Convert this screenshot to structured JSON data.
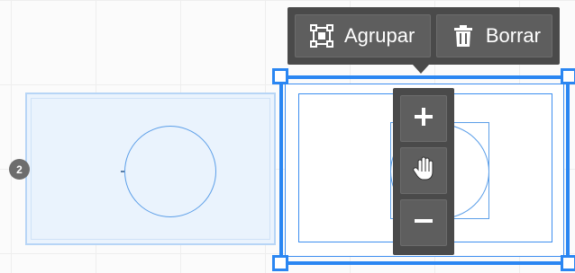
{
  "toolbar": {
    "group_label": "Agrupar",
    "group_icon": "group-objects-icon",
    "delete_label": "Borrar",
    "delete_icon": "trash-icon"
  },
  "zoom_controls": {
    "zoom_in_icon": "plus-icon",
    "pan_icon": "hand-pan-icon",
    "zoom_out_icon": "minus-icon"
  },
  "canvas": {
    "badge_number": "2"
  },
  "colors": {
    "accent": "#2a86f2",
    "toolbar_bg": "#4a4a4a",
    "button_bg": "#5e5e5e",
    "unselected_fill": "#eaf3fd",
    "shape_stroke": "#5b9ee8"
  }
}
